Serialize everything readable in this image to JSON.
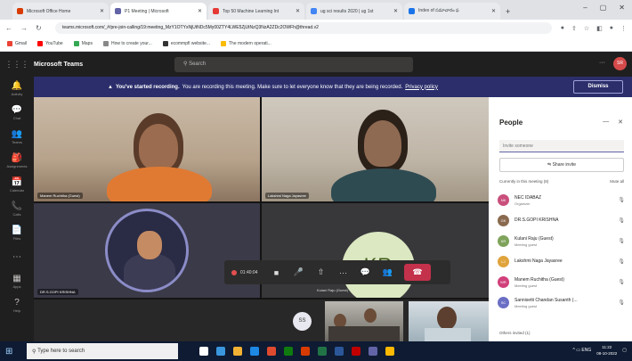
{
  "browser": {
    "tabs": [
      {
        "label": "Microsoft Office Home",
        "color": "#d83b01",
        "active": false
      },
      {
        "label": "P1 Meeting | Microsoft",
        "color": "#6264a7",
        "active": true
      },
      {
        "label": "Top 50 Machine Learning Int",
        "color": "#e53935",
        "active": false
      },
      {
        "label": "ug sci results 2020 | ug 1st",
        "color": "#4285f4",
        "active": false
      },
      {
        "label": "Index of సమాచారం ఫ",
        "color": "#1a73e8",
        "active": false
      }
    ],
    "new_tab": "+",
    "url": "teams.microsoft.com/_#/pre-join-calling/19:meeting_MzY1OTYxNjUtNDc5My00ZTY4LWE5ZjUtNzQ3NzA2ZDc2OWFh@thread.v2",
    "bookmarks": [
      {
        "label": "Gmail",
        "color": "#ea4335"
      },
      {
        "label": "YouTube",
        "color": "#ff0000"
      },
      {
        "label": "Maps",
        "color": "#34a853"
      },
      {
        "label": "How to create your...",
        "color": "#888888"
      },
      {
        "label": "ecommpfi website...",
        "color": "#333333"
      },
      {
        "label": "The modern operati...",
        "color": "#fbbc05"
      }
    ]
  },
  "teams": {
    "app_name": "Microsoft Teams",
    "search_placeholder": "Search",
    "more": "···",
    "avatar_initials": "SR",
    "rail": [
      {
        "icon": "🔔",
        "label": "Activity"
      },
      {
        "icon": "💬",
        "label": "Chat"
      },
      {
        "icon": "👥",
        "label": "Teams"
      },
      {
        "icon": "🎒",
        "label": "Assignments"
      },
      {
        "icon": "📅",
        "label": "Calendar"
      },
      {
        "icon": "📞",
        "label": "Calls"
      },
      {
        "icon": "📄",
        "label": "Files"
      },
      {
        "icon": "⋯",
        "label": ""
      },
      {
        "icon": "▦",
        "label": "Apps"
      },
      {
        "icon": "?",
        "label": "Help"
      }
    ]
  },
  "banner": {
    "icon": "▲",
    "bold": "You've started recording.",
    "message": "You are recording this meeting. Make sure to let everyone know that they are being recorded.",
    "link": "Privacy policy",
    "dismiss": "Dismiss"
  },
  "stage": {
    "tile1_name": "Manem Ruchitha (Guest)",
    "tile2_name": "Lakshmi Naga Jayasree",
    "tile3_name": "DR.S.GOPI KRISHNA",
    "tile4_initials": "KR",
    "timer": "01:40:04",
    "host_label": "Kulani Raju (Guest)",
    "ss_initials": "SS"
  },
  "people": {
    "title": "People",
    "invite_placeholder": "Invite someone",
    "share_invite": "Share invite",
    "section_label": "Currently in this meeting (8)",
    "mute_all": "Mute all",
    "participants": [
      {
        "initials": "NK",
        "name": "NEC IDABAZ",
        "role": "Organizer",
        "color": "#c94f7c"
      },
      {
        "initials": "GK",
        "name": "DR.S.GOPI KRISHNA",
        "role": "",
        "color": "#8a6a4f"
      },
      {
        "initials": "KR",
        "name": "Kulani Raju (Guest)",
        "role": "Meeting guest",
        "color": "#7fa35b"
      },
      {
        "initials": "LJ",
        "name": "Lakshmi Naga Jayasree",
        "role": "",
        "color": "#e0a43c"
      },
      {
        "initials": "MR",
        "name": "Manem Ruchitha (Guest)",
        "role": "Meeting guest",
        "color": "#d0407a"
      },
      {
        "initials": "SC",
        "name": "Sannisetti Chandan Susanth (...",
        "role": "Meeting guest",
        "color": "#6a6fc4"
      }
    ],
    "others": "Others invited (1)"
  },
  "taskbar": {
    "search_placeholder": "Type here to search",
    "apps": [
      "#ffffff",
      "#3a96dd",
      "#f2b233",
      "#1e88e5",
      "#e04a2f",
      "#0f7b0f",
      "#d83b01",
      "#217346",
      "#2b579a",
      "#c00000",
      "#6264a7",
      "#ffb900"
    ],
    "tray": "^ ▭ ENG",
    "time": "11:22",
    "date": "08-10-2022"
  }
}
